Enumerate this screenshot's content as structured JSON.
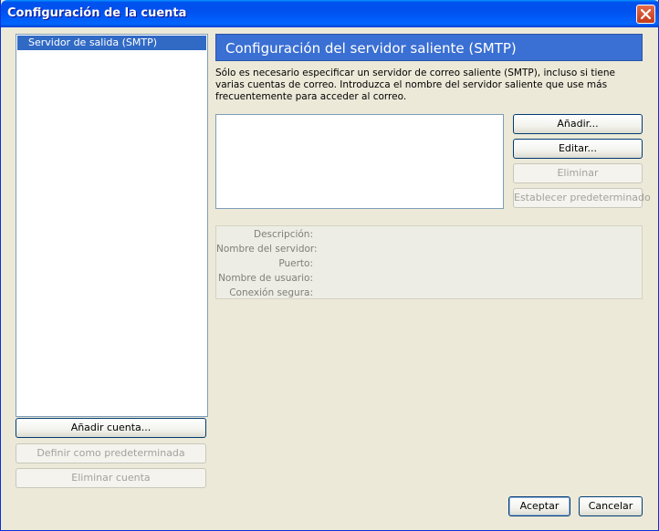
{
  "window": {
    "title": "Configuración de la cuenta"
  },
  "accounts": {
    "items": [
      {
        "label": "Servidor de salida (SMTP)"
      }
    ]
  },
  "left_buttons": {
    "add_account": "Añadir cuenta...",
    "set_default": "Definir como predeterminada",
    "remove_account": "Eliminar cuenta"
  },
  "main": {
    "heading": "Configuración del servidor saliente (SMTP)",
    "description": "Sólo es necesario especificar un servidor de correo saliente (SMTP), incluso si tiene varias cuentas de correo. Introduzca el nombre del servidor saliente que use más frecuentemente para acceder al correo.",
    "buttons": {
      "add": "Añadir...",
      "edit": "Editar...",
      "remove": "Eliminar",
      "set_default": "Establecer predeterminado"
    },
    "details": {
      "description_label": "Descripción:",
      "server_name_label": "Nombre del servidor:",
      "port_label": "Puerto:",
      "username_label": "Nombre de usuario:",
      "secure_connection_label": "Conexión segura:"
    }
  },
  "footer": {
    "accept": "Aceptar",
    "cancel": "Cancelar"
  }
}
